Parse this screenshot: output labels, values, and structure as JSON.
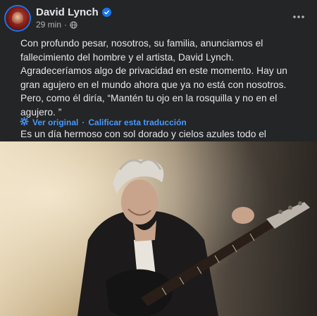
{
  "post": {
    "author": "David Lynch",
    "time": "29 min",
    "time_separator": "·",
    "paragraphs": [
      "Con profundo pesar, nosotros, su familia, anunciamos el fallecimiento del hombre y el artista, David Lynch. Agradeceríamos algo de privacidad en este momento. Hay un gran agujero en el mundo ahora que ya no está con nosotros. Pero, como él diría, “Mantén tu ojo en la rosquilla y no en el agujero. ”",
      "Es un día hermoso con sol dorado y cielos azules todo el camino."
    ],
    "see_original": "Ver original",
    "separator": "·",
    "rate_translation": "Calificar esta traducción"
  },
  "colors": {
    "background": "#242526",
    "text": "#e4e6eb",
    "secondary_text": "#b0b3b8",
    "link": "#4599ff",
    "verified": "#1877f2"
  },
  "icons": [
    "verified-badge-icon",
    "globe-icon",
    "more-options-icon",
    "translate-gear-icon"
  ],
  "photo": {
    "subject": "man-playing-electric-guitar"
  }
}
